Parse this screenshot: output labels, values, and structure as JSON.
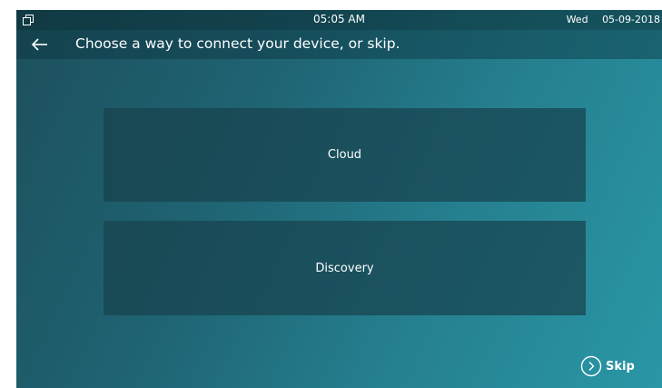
{
  "status_bar": {
    "time": "05:05 AM",
    "day": "Wed",
    "date": "05-09-2018",
    "icon": "window-restore-icon"
  },
  "header": {
    "back_icon": "arrow-left-icon",
    "title": "Choose a way to connect your device, or skip."
  },
  "options": [
    {
      "label": "Cloud"
    },
    {
      "label": "Discovery"
    }
  ],
  "skip": {
    "label": "Skip",
    "icon": "chevron-right-circle-icon"
  },
  "colors": {
    "bg_start": "#1d4f5c",
    "bg_end": "#2a97a6",
    "card": "#18424d",
    "text": "#ffffff"
  }
}
